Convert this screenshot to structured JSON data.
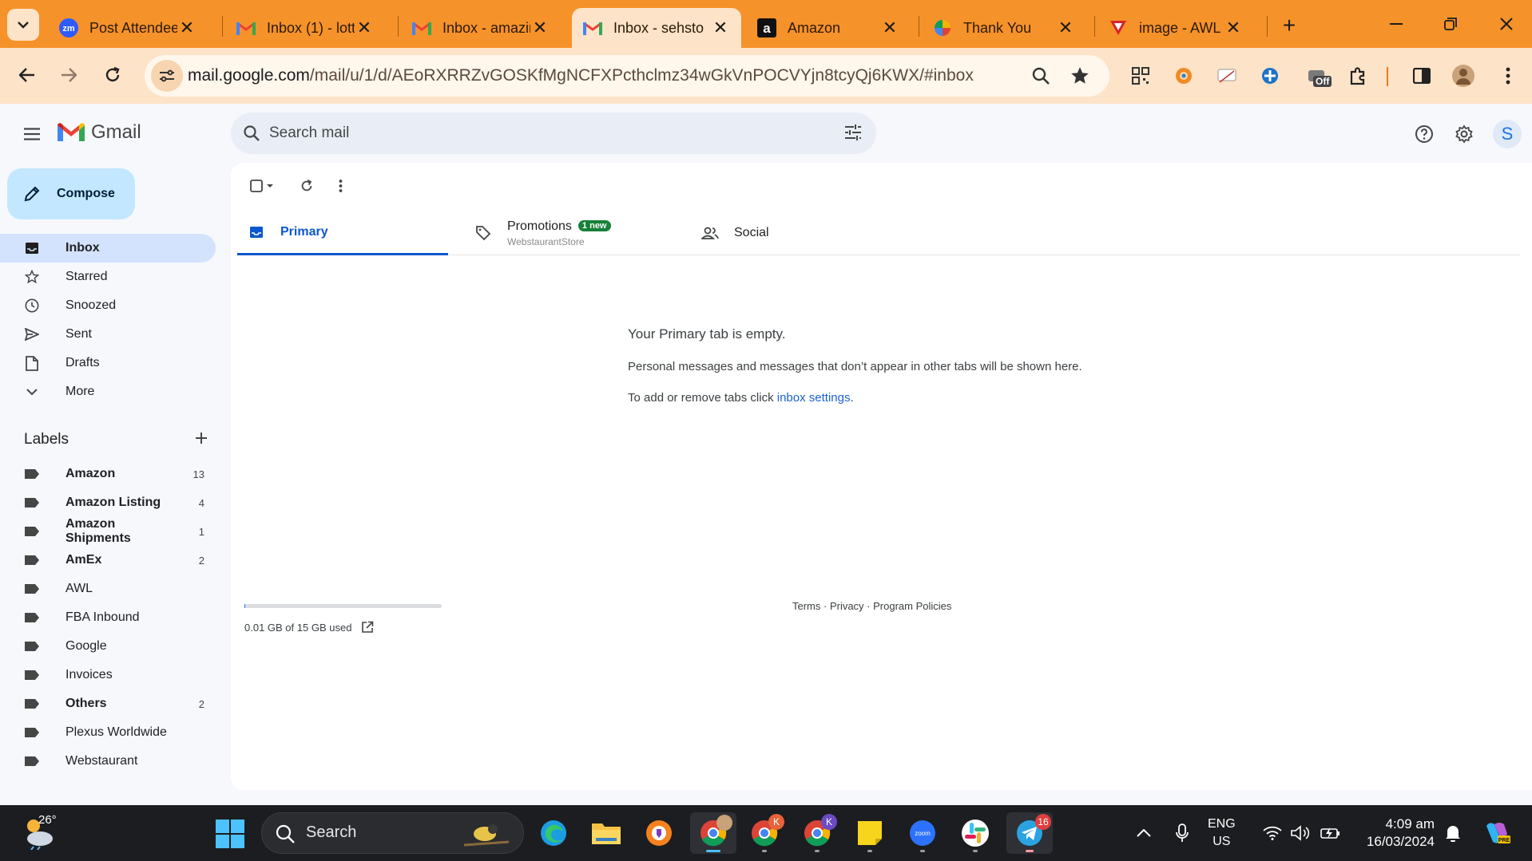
{
  "browser": {
    "tabs": [
      {
        "title": "Post Attendee",
        "favicon": "zoom-icon",
        "active": false
      },
      {
        "title": "Inbox (1) - lott",
        "favicon": "gmail-icon",
        "active": false
      },
      {
        "title": "Inbox - amazin",
        "favicon": "gmail-icon",
        "active": false
      },
      {
        "title": "Inbox - sehsto",
        "favicon": "gmail-icon",
        "active": true
      },
      {
        "title": "Amazon",
        "favicon": "amazon-icon",
        "active": false
      },
      {
        "title": "Thank You",
        "favicon": "pinwheel-icon",
        "active": false
      },
      {
        "title": "image - AWL I",
        "favicon": "awl-icon",
        "active": false
      }
    ],
    "url_host": "mail.google.com",
    "url_path": "/mail/u/1/d/AEoRXRRZvGOSKfMgNCFXPcthclmz34wGkVnPOCVYjn8tcyQj6KWX/#inbox",
    "extension_badge": "Off",
    "accent": "#f6922a"
  },
  "gmail": {
    "brand": "Gmail",
    "search_placeholder": "Search mail",
    "avatar_initial": "S",
    "compose_label": "Compose",
    "nav": [
      {
        "label": "Inbox",
        "icon": "inbox-icon",
        "active": true
      },
      {
        "label": "Starred",
        "icon": "star-icon",
        "active": false
      },
      {
        "label": "Snoozed",
        "icon": "clock-icon",
        "active": false
      },
      {
        "label": "Sent",
        "icon": "send-icon",
        "active": false
      },
      {
        "label": "Drafts",
        "icon": "draft-icon",
        "active": false
      },
      {
        "label": "More",
        "icon": "chevron-down-icon",
        "active": false
      }
    ],
    "labels_heading": "Labels",
    "labels": [
      {
        "name": "Amazon",
        "count": "13",
        "bold": true
      },
      {
        "name": "Amazon Listing",
        "count": "4",
        "bold": true
      },
      {
        "name": "Amazon Shipments",
        "count": "1",
        "bold": true
      },
      {
        "name": "AmEx",
        "count": "2",
        "bold": true
      },
      {
        "name": "AWL",
        "count": "",
        "bold": false
      },
      {
        "name": "FBA Inbound",
        "count": "",
        "bold": false
      },
      {
        "name": "Google",
        "count": "",
        "bold": false
      },
      {
        "name": "Invoices",
        "count": "",
        "bold": false
      },
      {
        "name": "Others",
        "count": "2",
        "bold": true
      },
      {
        "name": "Plexus Worldwide",
        "count": "",
        "bold": false
      },
      {
        "name": "Webstaurant",
        "count": "",
        "bold": false
      }
    ],
    "tabs": {
      "primary": "Primary",
      "promotions": "Promotions",
      "promotions_badge": "1 new",
      "promotions_sender": "WebstaurantStore",
      "social": "Social"
    },
    "empty": {
      "title": "Your Primary tab is empty.",
      "line1": "Personal messages and messages that don’t appear in other tabs will be shown here.",
      "line2_prefix": "To add or remove tabs click ",
      "line2_link": "inbox settings",
      "line2_suffix": "."
    },
    "storage": {
      "text": "0.01 GB of 15 GB used",
      "used_fraction": 0.001
    },
    "footer": "Terms · Privacy · Program Policies"
  },
  "taskbar": {
    "temperature": "26°",
    "search_placeholder": "Search",
    "telegram_badge": "16",
    "chrome2_badge": "K",
    "chrome3_badge": "K",
    "lang_top": "ENG",
    "lang_bottom": "US",
    "time": "4:09 am",
    "date": "16/03/2024"
  }
}
